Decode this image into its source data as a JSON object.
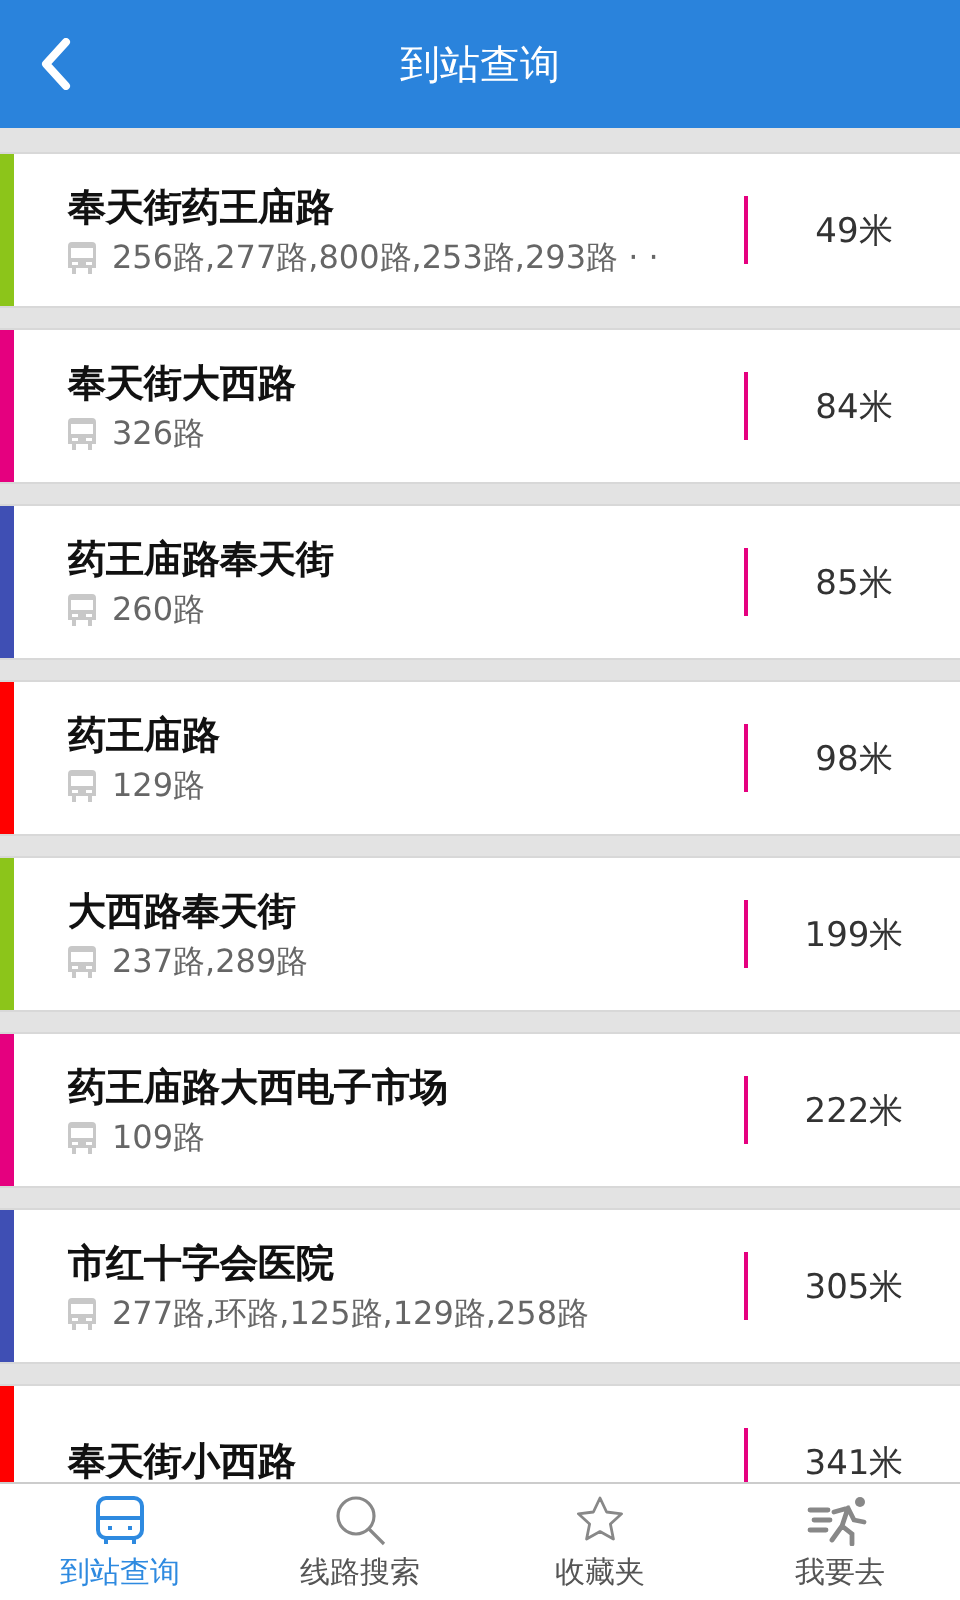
{
  "header": {
    "title": "到站查询"
  },
  "stops": [
    {
      "name": "奉天街药王庙路",
      "routes": "256路,277路,800路,253路,293路 · ·",
      "distance": "49米",
      "color": "#8cc51a"
    },
    {
      "name": "奉天街大西路",
      "routes": "326路",
      "distance": "84米",
      "color": "#e5007f"
    },
    {
      "name": "药王庙路奉天街",
      "routes": "260路",
      "distance": "85米",
      "color": "#3f4fb4"
    },
    {
      "name": "药王庙路",
      "routes": "129路",
      "distance": "98米",
      "color": "#ff0000"
    },
    {
      "name": "大西路奉天街",
      "routes": "237路,289路",
      "distance": "199米",
      "color": "#8cc51a"
    },
    {
      "name": "药王庙路大西电子市场",
      "routes": "109路",
      "distance": "222米",
      "color": "#e5007f"
    },
    {
      "name": "市红十字会医院",
      "routes": "277路,环路,125路,129路,258路",
      "distance": "305米",
      "color": "#3f4fb4"
    },
    {
      "name": "奉天街小西路",
      "distance": "341米",
      "color": "#ff0000"
    }
  ],
  "tabs": [
    {
      "label": "到站查询",
      "kind": "bus",
      "selected": true
    },
    {
      "label": "线路搜索",
      "kind": "search",
      "selected": false
    },
    {
      "label": "收藏夹",
      "kind": "star",
      "selected": false
    },
    {
      "label": "我要去",
      "kind": "run",
      "selected": false
    }
  ]
}
